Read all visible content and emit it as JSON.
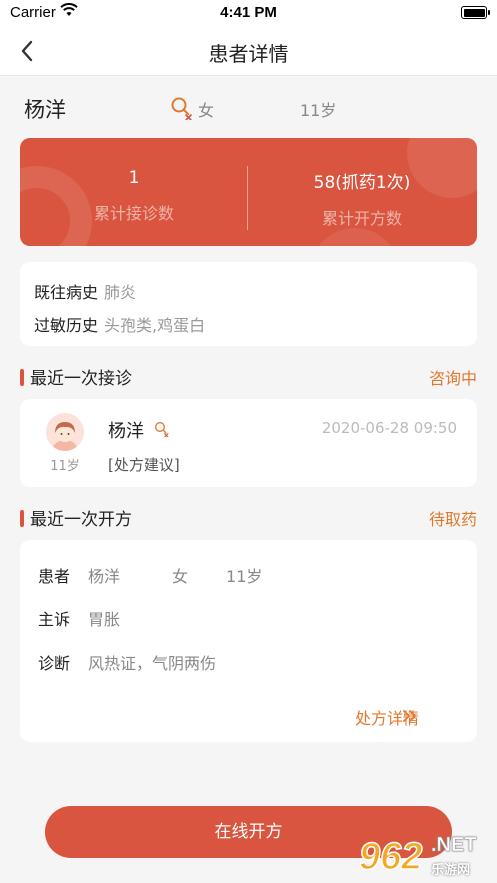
{
  "status_bar": {
    "carrier": "Carrier",
    "time": "4:41 PM"
  },
  "nav": {
    "title": "患者详情"
  },
  "patient": {
    "name": "杨洋",
    "gender": "女",
    "age": "11岁"
  },
  "stats": {
    "visits_value": "1",
    "visits_label": "累计接诊数",
    "prescriptions_value": "58(抓药1次)",
    "prescriptions_label": "累计开方数"
  },
  "history": {
    "past_label": "既往病史",
    "past_value": "肺炎",
    "allergy_label": "过敏历史",
    "allergy_value": "头孢类,鸡蛋白"
  },
  "recent_visit": {
    "section_title": "最近一次接诊",
    "status": "咨询中",
    "name": "杨洋",
    "age": "11岁",
    "time": "2020-06-28 09:50",
    "note": "[处方建议]"
  },
  "recent_rx": {
    "section_title": "最近一次开方",
    "status": "待取药",
    "patient_label": "患者",
    "patient_name": "杨洋",
    "patient_gender": "女",
    "patient_age": "11岁",
    "complaint_label": "主诉",
    "complaint_value": "胃胀",
    "diagnosis_label": "诊断",
    "diagnosis_value": "风热证，气阴两伤",
    "detail_link": "处方详情"
  },
  "cta": {
    "label": "在线开方"
  },
  "watermark": {
    "number": "962",
    "site_text": ".NET",
    "subtitle": "乐游网"
  },
  "colors": {
    "primary": "#d9553f",
    "accent": "#e2782c",
    "background": "#f5f5f5"
  }
}
